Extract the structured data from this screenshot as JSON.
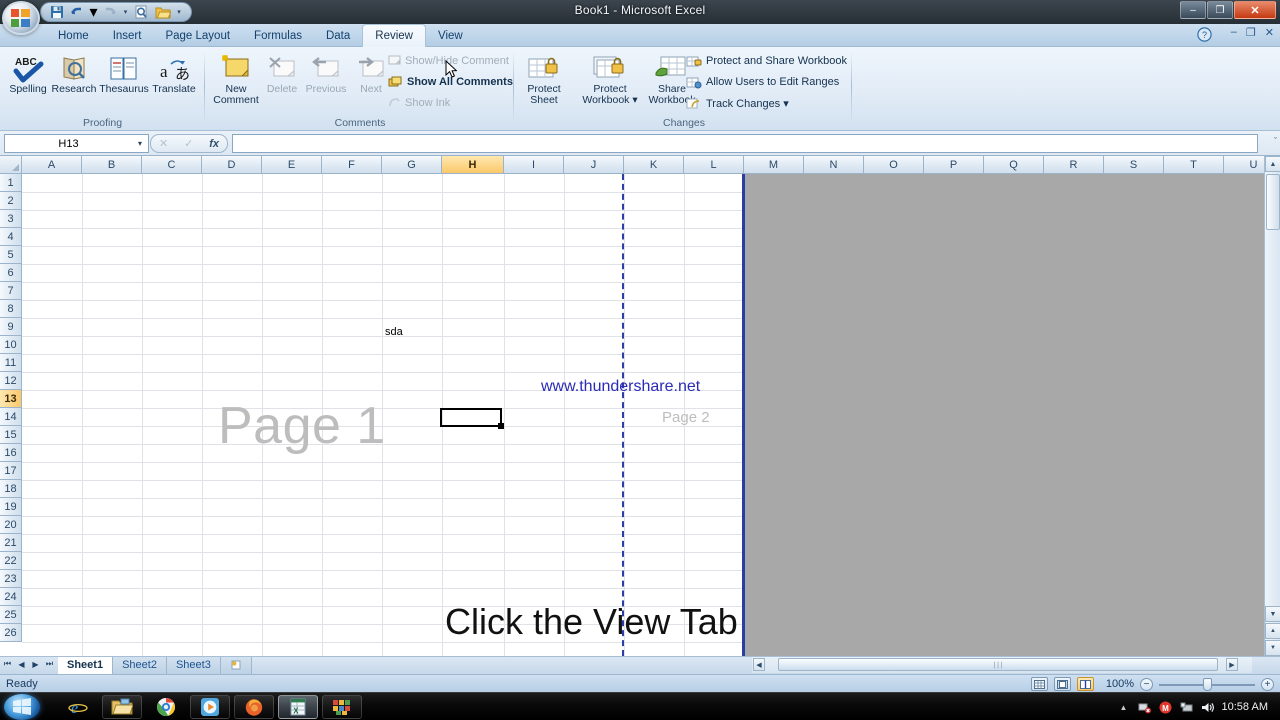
{
  "window": {
    "title": "Book1 - Microsoft Excel",
    "minimize": "–",
    "restore": "❐",
    "close": "✕"
  },
  "quick_access": {
    "save": "save-icon",
    "undo": "undo-icon",
    "undo_more": "▾",
    "redo": "redo-icon",
    "redo_more": "▾",
    "print_preview": "print-preview-icon",
    "open": "open-icon",
    "customize": "▾"
  },
  "ribbon": {
    "tabs": [
      {
        "label": "Home",
        "active": false
      },
      {
        "label": "Insert",
        "active": false
      },
      {
        "label": "Page Layout",
        "active": false
      },
      {
        "label": "Formulas",
        "active": false
      },
      {
        "label": "Data",
        "active": false
      },
      {
        "label": "Review",
        "active": true
      },
      {
        "label": "View",
        "active": false
      }
    ],
    "help": "?",
    "minimize_ribbon": "–",
    "restore_window": "❐",
    "close_window": "✕",
    "groups": [
      {
        "name": "Proofing",
        "label": "Proofing",
        "buttons": [
          {
            "label": "Spelling",
            "icon": "spelling-icon"
          },
          {
            "label": "Research",
            "icon": "research-icon"
          },
          {
            "label": "Thesaurus",
            "icon": "thesaurus-icon"
          },
          {
            "label": "Translate",
            "icon": "translate-icon"
          }
        ]
      },
      {
        "name": "Comments",
        "label": "Comments",
        "buttons": [
          {
            "label": "New\nComment",
            "label_1": "New",
            "label_2": "Comment",
            "icon": "new-comment-icon",
            "disabled": false
          },
          {
            "label": "Delete",
            "icon": "delete-comment-icon",
            "disabled": true
          },
          {
            "label": "Previous",
            "icon": "previous-comment-icon",
            "disabled": true
          },
          {
            "label": "Next",
            "icon": "next-comment-icon",
            "disabled": true
          }
        ],
        "small_items": [
          {
            "label": "Show/Hide Comment",
            "icon": "show-hide-comment-icon",
            "disabled": true
          },
          {
            "label": "Show All Comments",
            "icon": "show-all-comments-icon",
            "disabled": false
          },
          {
            "label": "Show Ink",
            "icon": "show-ink-icon",
            "disabled": true
          }
        ]
      },
      {
        "name": "Changes",
        "label": "Changes",
        "buttons": [
          {
            "label_1": "Protect",
            "label_2": "Sheet",
            "icon": "protect-sheet-icon"
          },
          {
            "label_1": "Protect",
            "label_2": "Workbook ▾",
            "icon": "protect-workbook-icon"
          },
          {
            "label_1": "Share",
            "label_2": "Workbook",
            "icon": "share-workbook-icon"
          }
        ],
        "small_items": [
          {
            "label": "Protect and Share Workbook",
            "icon": "protect-share-workbook-icon"
          },
          {
            "label": "Allow Users to Edit Ranges",
            "icon": "allow-users-edit-ranges-icon"
          },
          {
            "label": "Track Changes ▾",
            "icon": "track-changes-icon"
          }
        ]
      }
    ]
  },
  "formula_bar": {
    "name_box_value": "H13",
    "name_box_caret": "▾",
    "cancel": "✕",
    "enter": "✓",
    "insert_function": "fx",
    "formula_value": "",
    "expand": "ˇ"
  },
  "grid": {
    "columns": [
      "A",
      "B",
      "C",
      "D",
      "E",
      "F",
      "G",
      "H",
      "I",
      "J",
      "K",
      "L",
      "M",
      "N",
      "O",
      "P",
      "Q",
      "R",
      "S",
      "T",
      "U"
    ],
    "selected_column": "H",
    "rows": [
      1,
      2,
      3,
      4,
      5,
      6,
      7,
      8,
      9,
      10,
      11,
      12,
      13,
      14,
      15,
      16,
      17,
      18,
      19,
      20,
      21,
      22,
      23,
      24,
      25,
      26
    ],
    "selected_row": 13,
    "selected_cell": "H13",
    "watermarks": [
      {
        "text": "Page 1",
        "name": "page-1-watermark"
      },
      {
        "text": "Page 2",
        "name": "page-2-watermark"
      }
    ],
    "cell_entries": [
      {
        "ref": "F9",
        "text": "sda",
        "name": "cell-text-sda"
      }
    ],
    "link_text": "www.thundershare.net",
    "caption_text": "Click the View Tab"
  },
  "sheet_tabs": {
    "nav_first": "⏮",
    "nav_prev": "◀",
    "nav_next": "▶",
    "nav_last": "⏭",
    "tabs": [
      {
        "label": "Sheet1",
        "active": true
      },
      {
        "label": "Sheet2",
        "active": false
      },
      {
        "label": "Sheet3",
        "active": false
      }
    ],
    "insert_sheet": "insert-worksheet-icon"
  },
  "scrollbars": {
    "h_left_arrow": "◀",
    "h_right_arrow": "▶",
    "v_up_arrow": "▲",
    "v_down_arrow": "▼",
    "grip": "∣∣∣"
  },
  "status_bar": {
    "status": "Ready",
    "views": [
      {
        "name": "normal-view-button",
        "icon": "normal-view-icon",
        "active": false
      },
      {
        "name": "page-layout-view-button",
        "icon": "page-layout-view-icon",
        "active": false
      },
      {
        "name": "page-break-preview-button",
        "icon": "page-break-preview-icon",
        "active": true
      }
    ],
    "zoom_label": "100%",
    "zoom_out": "−",
    "zoom_in": "+"
  },
  "taskbar": {
    "start": "start-orb-icon",
    "items": [
      {
        "name": "taskbar-internet-explorer",
        "icon": "internet-explorer-icon",
        "active": false,
        "plain": true
      },
      {
        "name": "taskbar-file-explorer",
        "icon": "file-explorer-icon",
        "active": false,
        "plain": false
      },
      {
        "name": "taskbar-chrome",
        "icon": "chrome-icon",
        "active": false,
        "plain": true
      },
      {
        "name": "taskbar-media-player",
        "icon": "media-player-icon",
        "active": false,
        "plain": false
      },
      {
        "name": "taskbar-firefox",
        "icon": "firefox-icon",
        "active": false,
        "plain": false
      },
      {
        "name": "taskbar-excel",
        "icon": "excel-icon",
        "active": true,
        "plain": false
      },
      {
        "name": "taskbar-archiver",
        "icon": "archiver-icon",
        "active": false,
        "plain": false
      }
    ],
    "tray": {
      "show_hidden": "▲",
      "icons": [
        "network-error-icon",
        "mail-icon",
        "display-icon",
        "volume-icon"
      ],
      "clock": "10:58 AM"
    }
  },
  "colors": {
    "accent_blue": "#2b3ea8",
    "selection_orange": "#fbc86a",
    "link_blue": "#2b2bb5",
    "watermark_gray": "#bdbdbd",
    "outside_print_gray": "#a8a8a8"
  }
}
